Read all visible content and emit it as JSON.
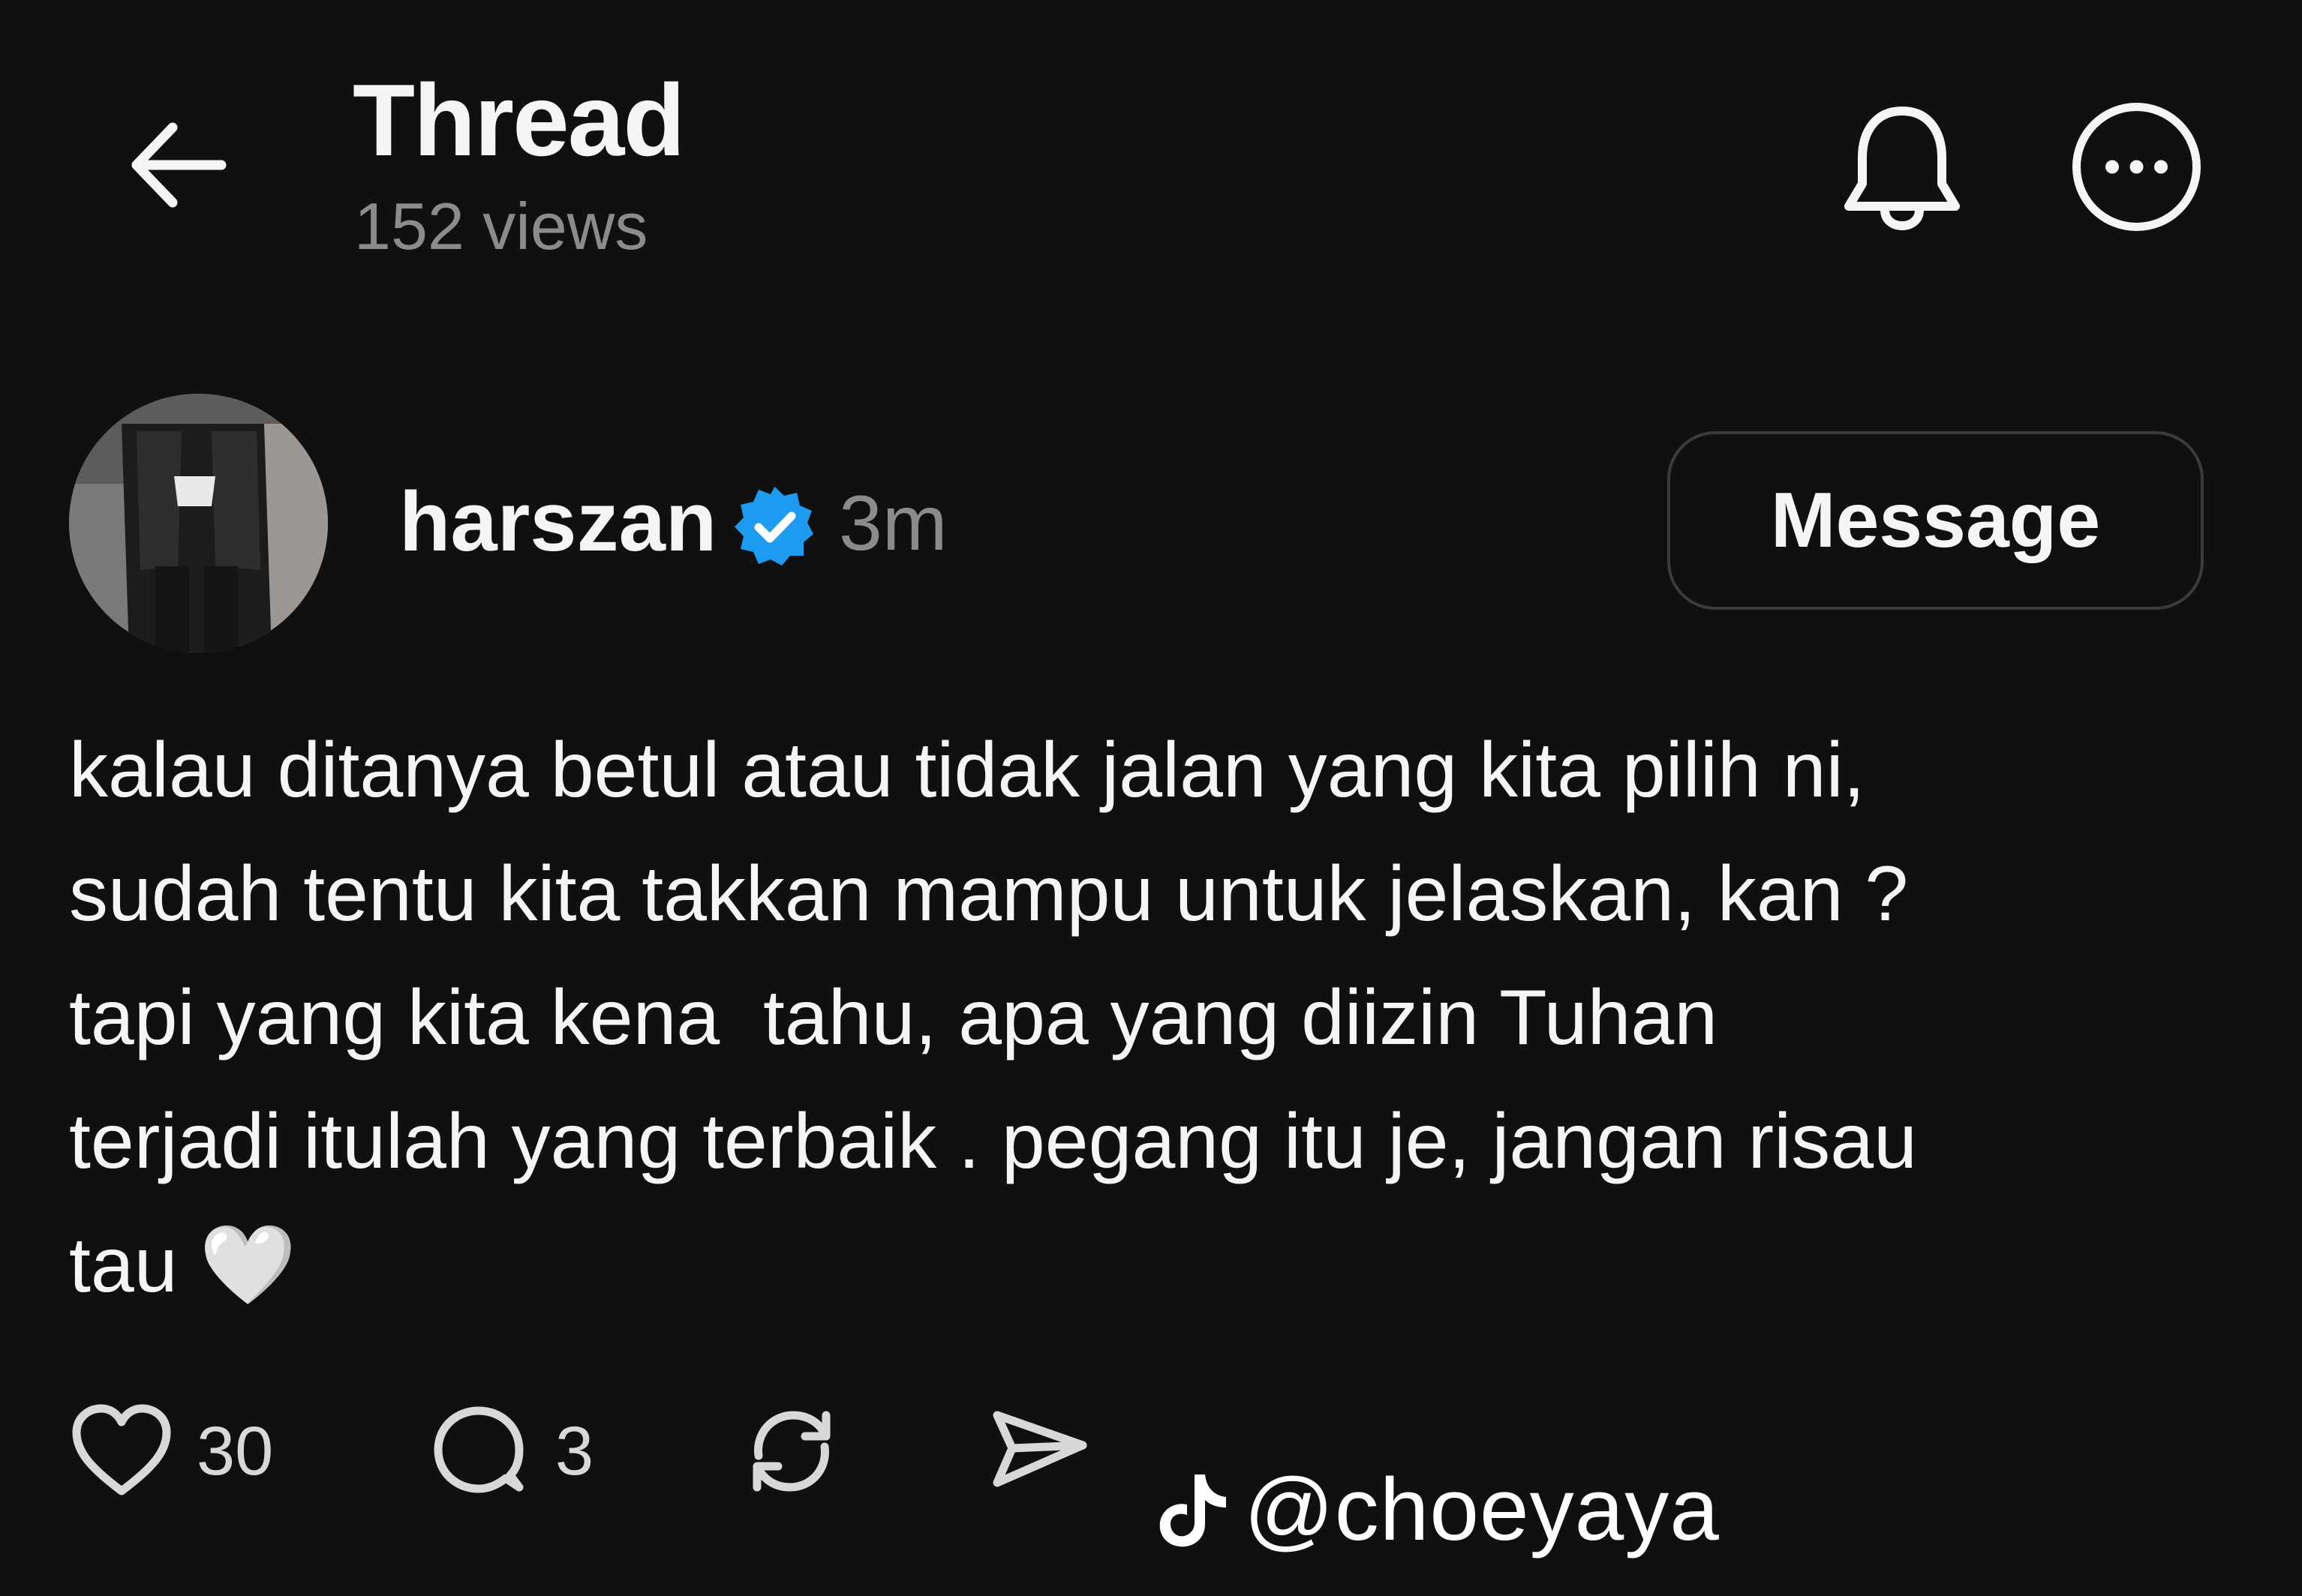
{
  "header": {
    "title": "Thread",
    "views": "152 views"
  },
  "post": {
    "author": "harszan",
    "time": "3m",
    "message_button": "Message",
    "text": "kalau ditanya betul atau tidak jalan yang kita pilih ni,\nsudah tentu kita takkan mampu untuk jelaskan, kan ?\ntapi yang kita kena  tahu, apa yang diizin Tuhan\nterjadi itulah yang terbaik . pegang itu je, jangan risau\ntau 🤍"
  },
  "actions": {
    "likes": "30",
    "replies": "3"
  },
  "watermark": {
    "handle": "@choeyaya"
  },
  "icons": [
    "back-arrow-icon",
    "bell-icon",
    "more-icon",
    "verified-badge-icon",
    "heart-icon",
    "comment-icon",
    "repost-icon",
    "share-icon",
    "tiktok-logo-icon"
  ],
  "colors": {
    "background": "#101010",
    "text": "#f3f5f7",
    "muted": "#8b8b8b",
    "verified": "#1d9bf0"
  }
}
